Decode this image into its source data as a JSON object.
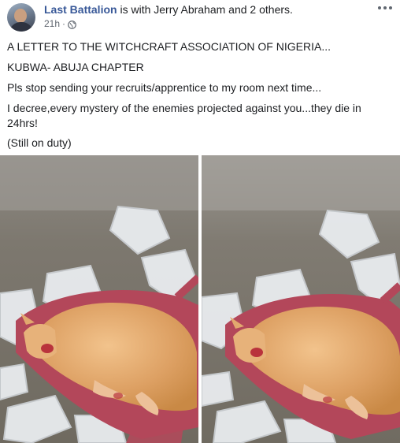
{
  "post": {
    "author": "Last Battalion",
    "with_text": "is with Jerry Abraham and 2 others.",
    "time": "21h",
    "separator": "·",
    "body_lines": [
      "A LETTER TO THE WITCHCRAFT ASSOCIATION OF NIGERIA...",
      "KUBWA- ABUJA CHAPTER",
      "Pls stop sending your recruits/apprentice to my room next time...",
      "I decree,every mystery of the enemies projected against you...they die in 24hrs!",
      "(Still on duty)"
    ]
  },
  "icons": {
    "privacy": "globe-icon",
    "more": "more-options-icon"
  },
  "colors": {
    "author_link": "#385898",
    "text": "#1c1e21",
    "meta": "#616770"
  }
}
